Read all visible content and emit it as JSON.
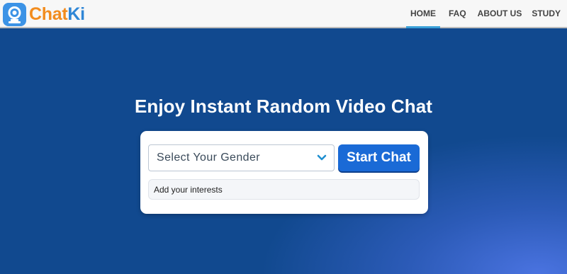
{
  "brand": {
    "name_part1": "Chat",
    "name_part2": "Ki",
    "icon": "webcam-icon",
    "colors": {
      "chat": "#f28c1e",
      "ki": "#2f86d6"
    }
  },
  "nav": {
    "items": [
      {
        "label": "HOME",
        "active": true
      },
      {
        "label": "FAQ",
        "active": false
      },
      {
        "label": "ABOUT US",
        "active": false
      },
      {
        "label": "STUDY",
        "active": false
      }
    ]
  },
  "hero": {
    "title": "Enjoy Instant Random Video Chat"
  },
  "form": {
    "gender_select": {
      "selected": "Select Your Gender",
      "icon": "chevron-down-icon"
    },
    "start_button_label": "Start Chat",
    "interests_placeholder": "Add your interests"
  },
  "colors": {
    "background": "#11498f",
    "accent": "#1a6ad6",
    "nav_underline": "#3aa0d8"
  }
}
